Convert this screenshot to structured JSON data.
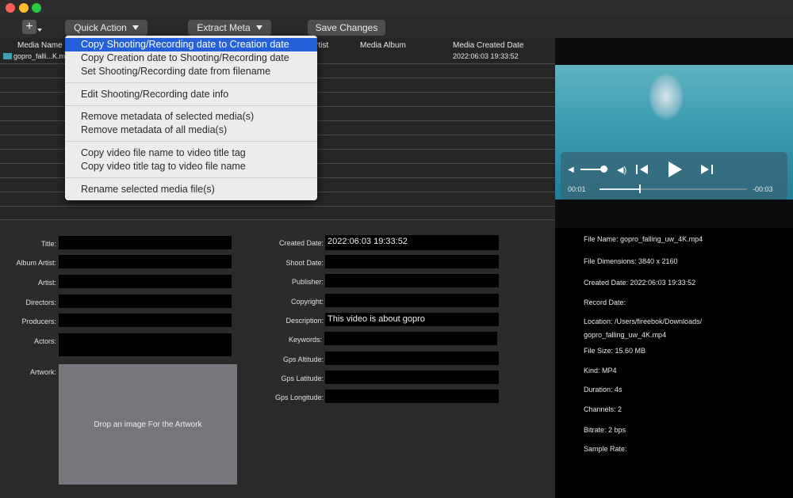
{
  "toolbar": {
    "add_label": "+",
    "quick_action": "Quick Action",
    "extract_meta": "Extract Meta",
    "save_changes": "Save Changes"
  },
  "table": {
    "headers": {
      "media_name": "Media Name",
      "artist_partial": "rtist",
      "media_album": "Media Album",
      "media_created": "Media Created Date"
    },
    "row": {
      "name": "gopro_falli...K.mp",
      "created": "2022:06:03 19:33:52"
    }
  },
  "menu": {
    "items": [
      "Copy Shooting/Recording date to Creation date",
      "Copy Creation date to Shooting/Recording date",
      "Set Shooting/Recording date from filename",
      "Edit Shooting/Recording date info",
      "Remove metadata of selected media(s)",
      "Remove metadata of all media(s)",
      "Copy video file name to video title tag",
      "Copy video title tag to video file name",
      "Rename selected media file(s)"
    ]
  },
  "player": {
    "elapsed": "00:01",
    "remaining": "-00:03",
    "volume_level": 0.8,
    "progress": 0.27
  },
  "form_left": {
    "title": "Title:",
    "album_artist": "Album Artist:",
    "artist": "Artist:",
    "directors": "Directors:",
    "producers": "Producers:",
    "actors": "Actors:",
    "artwork": "Artwork:",
    "artwork_placeholder": "Drop an image For the Artwork"
  },
  "form_right": {
    "created_date": "Created Date:",
    "created_date_value": "2022:06:03 19:33:52",
    "shoot_date": "Shoot Date:",
    "publisher": "Publisher:",
    "copyright": "Copyright:",
    "description": "Description:",
    "description_value": "This video is about gopro",
    "keywords": "Keywords:",
    "gps_altitude": "Gps Altitude:",
    "gps_latitude": "Gps Latitude:",
    "gps_longitude": "Gps Longitude:"
  },
  "info": {
    "file_name": "File Name: gopro_falling_uw_4K.mp4",
    "dimensions": "File Dimensions: 3840 x 2160",
    "created_date": "Created Date: 2022:06:03 19:33:52",
    "record_date": "Record Date:",
    "location_1": "Location: /Users/fireebok/Downloads/",
    "location_2": "gopro_falling_uw_4K.mp4",
    "file_size": "File Size: 15.60 MB",
    "kind": "Kind: MP4",
    "duration": "Duration: 4s",
    "channels": "Channels: 2",
    "bitrate": "Bitrate: 2 bps",
    "sample_rate": "Sample Rate:"
  },
  "colors": {
    "accent": "#2460d9",
    "close": "#fe5f57",
    "minimize": "#febc2e",
    "zoom": "#28c840"
  }
}
